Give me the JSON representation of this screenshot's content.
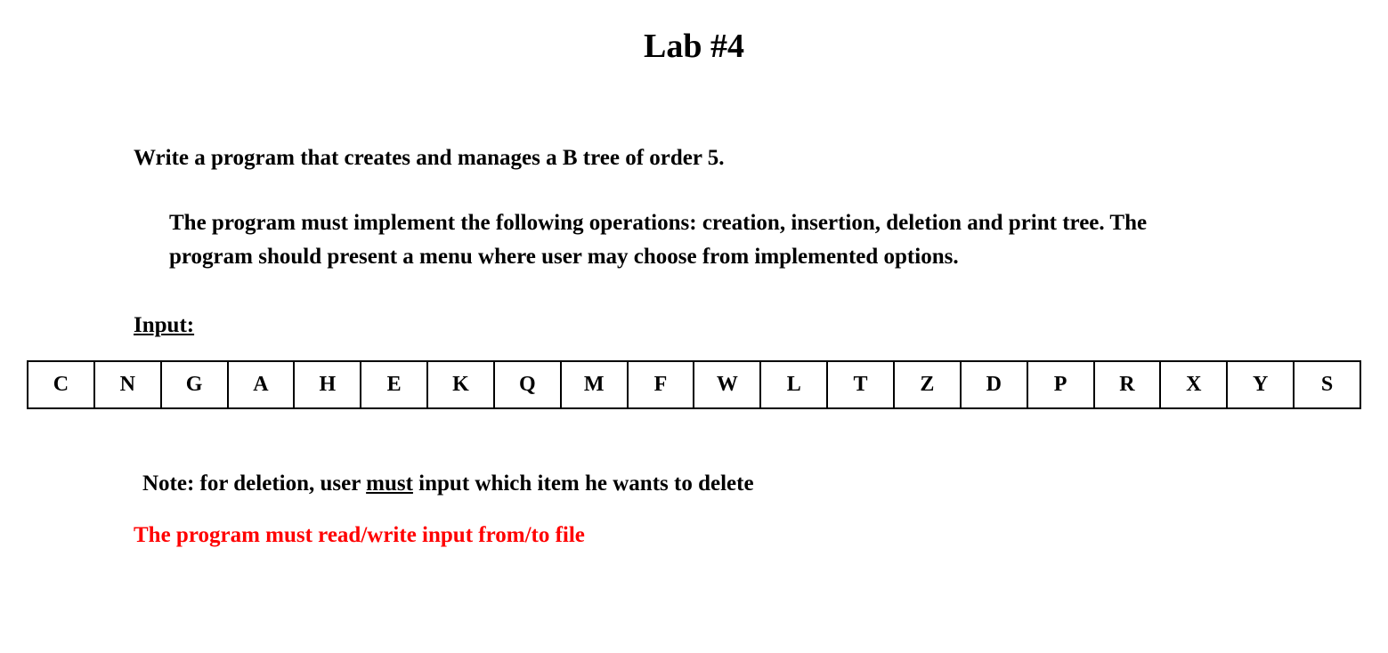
{
  "title": "Lab #4",
  "intro": "Write a program that creates and manages a B tree of order 5.",
  "description": "The program must implement the following operations: creation, insertion, deletion and print tree. The program should present a menu where user may choose from implemented options.",
  "input_label": "Input:",
  "input_cells": [
    "C",
    "N",
    "G",
    "A",
    "H",
    "E",
    "K",
    "Q",
    "M",
    "F",
    "W",
    "L",
    "T",
    "Z",
    "D",
    "P",
    "R",
    "X",
    "Y",
    "S"
  ],
  "note": {
    "prefix": "Note: for deletion, user ",
    "underlined": "must",
    "suffix": " input which item he wants to delete"
  },
  "file_requirement": "The program must read/write input from/to file"
}
